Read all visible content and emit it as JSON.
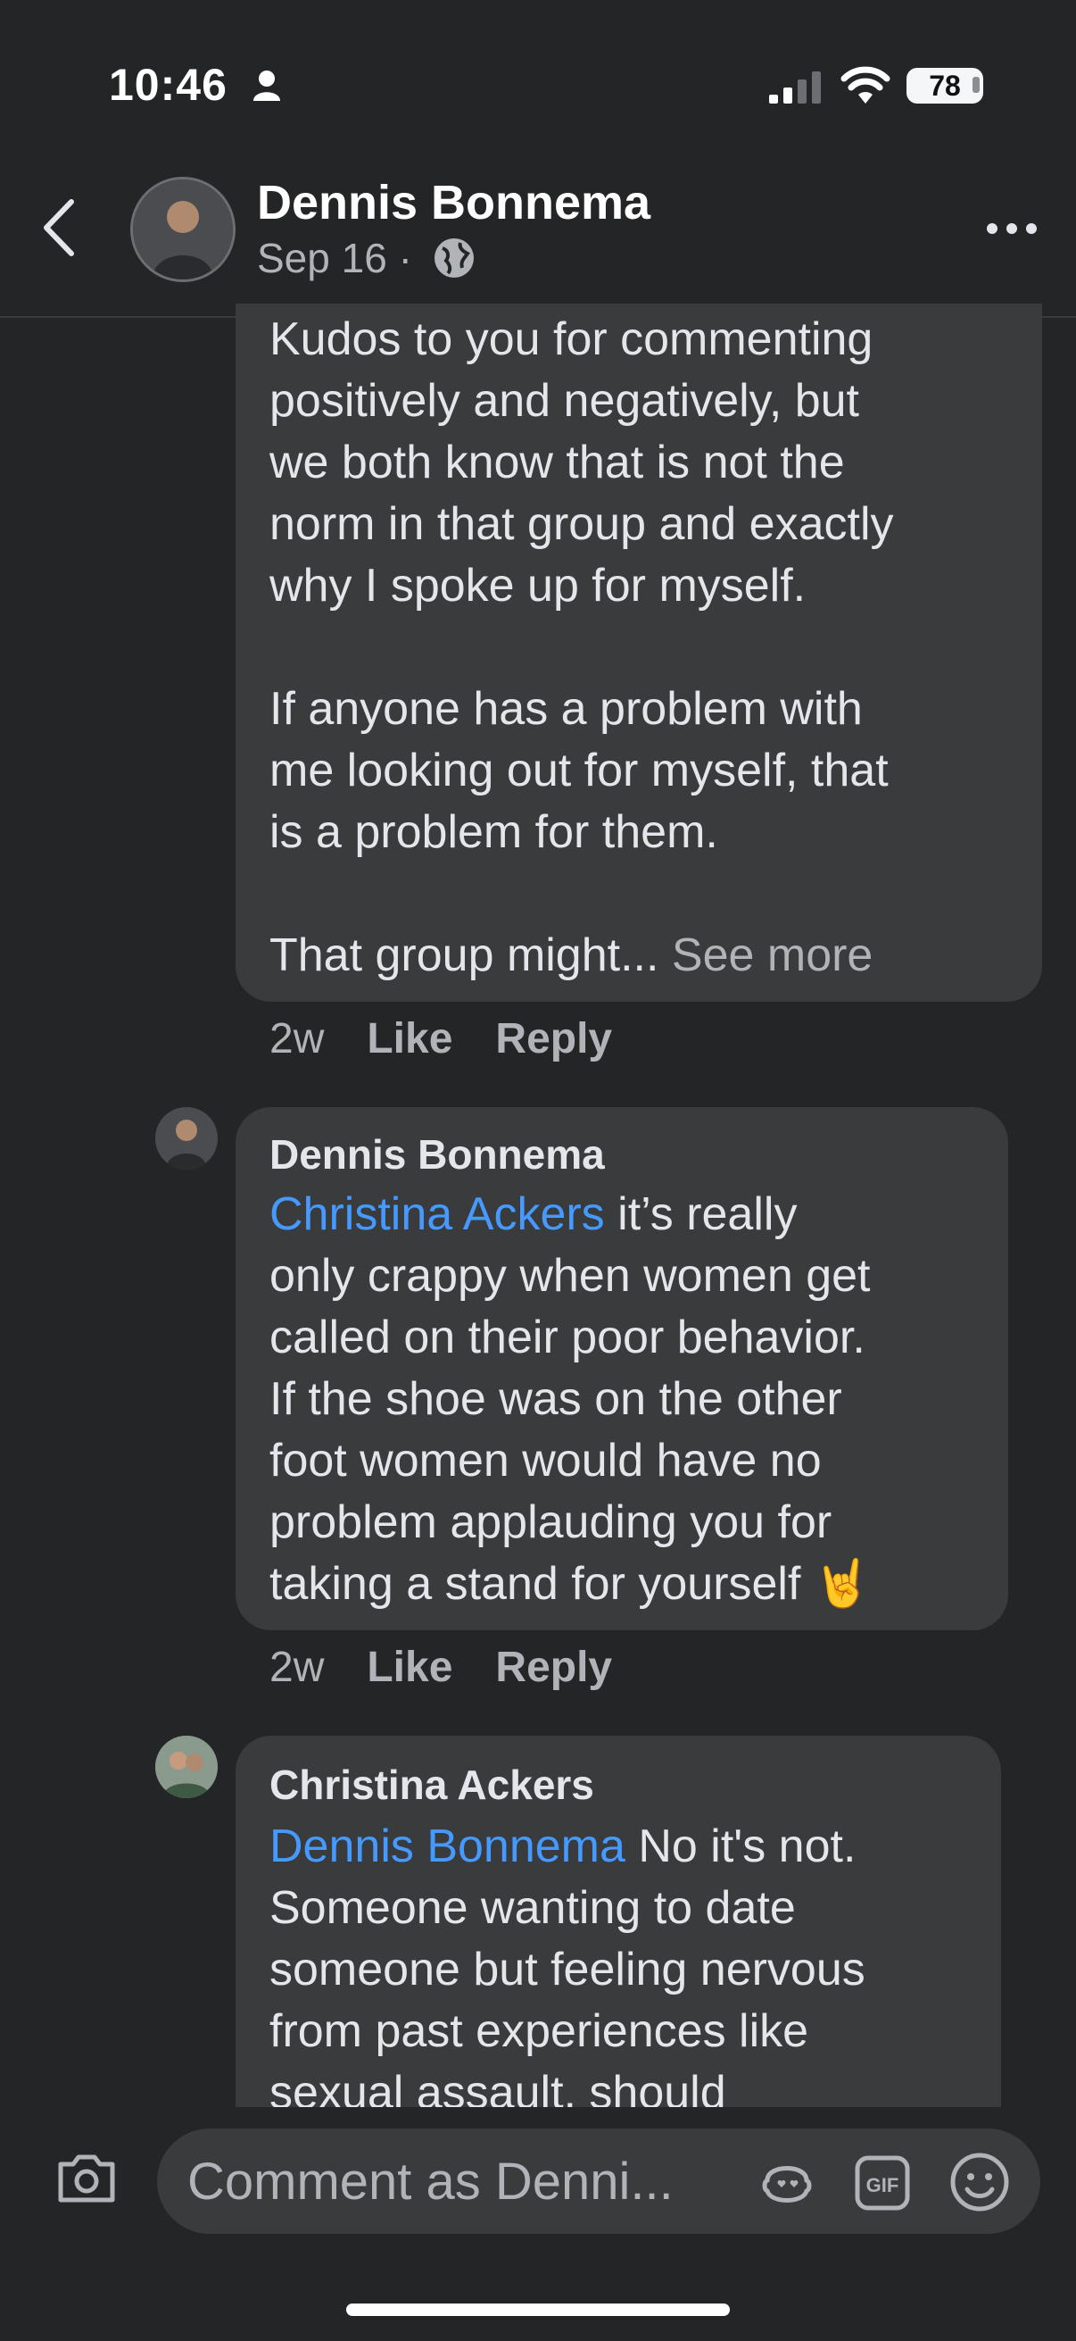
{
  "status_bar": {
    "time": "10:46",
    "battery": "78"
  },
  "header": {
    "name": "Dennis Bonnema",
    "date": "Sep 16 ·"
  },
  "comments": [
    {
      "text": "Kudos to you for commenting\npositively and negatively, but\nwe both know that is not the\nnorm in that group and exactly\nwhy I spoke up for myself.\n\nIf anyone has a problem with\nme looking out for myself, that\nis a problem for them.\n\nThat group might...",
      "see_more": "See more",
      "time": "2w",
      "like": "Like",
      "reply": "Reply"
    },
    {
      "author": "Dennis Bonnema",
      "mention": "Christina Ackers",
      "text": " it’s really\nonly crappy when women get\ncalled on their poor behavior.\nIf the shoe was on the other\nfoot women would have no\nproblem applauding you for\ntaking a stand for yourself 🤘",
      "time": "2w",
      "like": "Like",
      "reply": "Reply"
    },
    {
      "author": "Christina Ackers",
      "mention": "Dennis Bonnema",
      "text": " No it's not.\nSomeone wanting to date\nsomeone but feeling nervous\nfrom past experiences like\nsexual assault, should"
    }
  ],
  "composer": {
    "placeholder": "Comment as Denni..."
  },
  "icons": {
    "back": "chevron-left-icon",
    "globe": "globe-icon",
    "more": "more-icon",
    "camera": "camera-icon",
    "avatar_sticker": "avatar-sticker-icon",
    "gif": "gif-icon",
    "emoji": "emoji-icon"
  },
  "colors": {
    "background": "#242526",
    "bubble": "#3a3b3c",
    "mention": "#4599ff",
    "muted": "#b0b3b8"
  }
}
